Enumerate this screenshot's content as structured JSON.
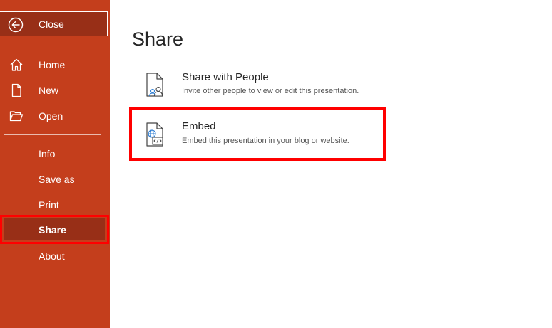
{
  "sidebar": {
    "close_label": "Close",
    "items": [
      {
        "label": "Home"
      },
      {
        "label": "New"
      },
      {
        "label": "Open"
      },
      {
        "label": "Info"
      },
      {
        "label": "Save as"
      },
      {
        "label": "Print"
      },
      {
        "label": "Share"
      },
      {
        "label": "About"
      }
    ],
    "selected": "Share"
  },
  "main": {
    "title": "Share",
    "options": [
      {
        "title": "Share with People",
        "description": "Invite other people to view or edit this presentation.",
        "icon": "share-with-people-icon"
      },
      {
        "title": "Embed",
        "description": "Embed this presentation in your blog or website.",
        "icon": "embed-icon"
      }
    ]
  },
  "colors": {
    "sidebar_bg": "#c43e1c",
    "sidebar_selected_bg": "#982f17",
    "highlight_border": "#ff0000",
    "icon_accent": "#2b7cd3"
  }
}
